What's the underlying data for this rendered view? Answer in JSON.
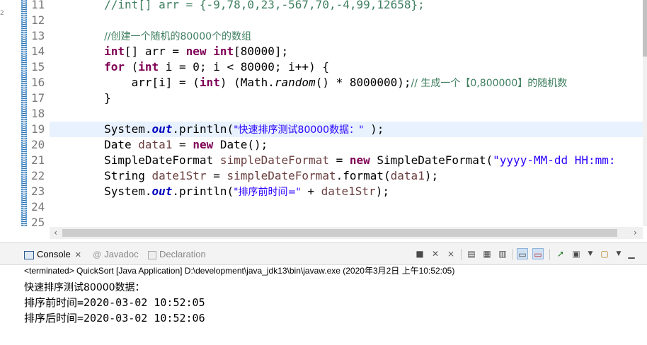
{
  "editor": {
    "gutter_mark": "2",
    "lines": [
      {
        "no": "11",
        "html_kind": "c11"
      },
      {
        "no": "12",
        "html_kind": "blank"
      },
      {
        "no": "13",
        "html_kind": "c13"
      },
      {
        "no": "14",
        "html_kind": "c14"
      },
      {
        "no": "15",
        "html_kind": "c15"
      },
      {
        "no": "16",
        "html_kind": "c16"
      },
      {
        "no": "17",
        "html_kind": "c17"
      },
      {
        "no": "18",
        "html_kind": "blank"
      },
      {
        "no": "19",
        "html_kind": "c19"
      },
      {
        "no": "20",
        "html_kind": "c20"
      },
      {
        "no": "21",
        "html_kind": "c21"
      },
      {
        "no": "22",
        "html_kind": "c22"
      },
      {
        "no": "23",
        "html_kind": "c23"
      },
      {
        "no": "24",
        "html_kind": "blank"
      },
      {
        "no": "25",
        "html_kind": "blank"
      }
    ],
    "code": {
      "l11": "        //int[] arr = {-9,78,0,23,-567,70,-4,99,12658};",
      "l13_comment": "//创建一个随机的80000个的数组",
      "l14_kw1": "int",
      "l14_a": "[] arr = ",
      "l14_kw2": "new",
      "l14_kw3": "int",
      "l14_b": "[80000];",
      "l15_kw1": "for",
      "l15_a": " (",
      "l15_kw2": "int",
      "l15_b": " i = 0; i < 80000; i++) {",
      "l16_a": "    arr[i] = (",
      "l16_kw": "int",
      "l16_b": ") (Math.",
      "l16_it": "random",
      "l16_c": "() * 8000000);",
      "l16_comment": "// 生成一个【0,800000】的随机数",
      "l17": "}",
      "l19_a": "System.",
      "l19_fld": "out",
      "l19_b": ".println(",
      "l19_str": "\"快速排序测试80000数据：\"",
      "l19_c": " );",
      "l20_a": "Date ",
      "l20_var": "data1",
      "l20_b": " = ",
      "l20_kw": "new",
      "l20_c": " Date();",
      "l21_a": "SimpleDateFormat ",
      "l21_var": "simpleDateFormat",
      "l21_b": " = ",
      "l21_kw": "new",
      "l21_c": " SimpleDateFormat(",
      "l21_str": "\"yyyy-MM-dd HH:mm:",
      "l22_a": "String ",
      "l22_var": "date1Str",
      "l22_b": " = ",
      "l22_var2": "simpleDateFormat",
      "l22_c": ".format(",
      "l22_var3": "data1",
      "l22_d": ");",
      "l23_a": "System.",
      "l23_fld": "out",
      "l23_b": ".println(",
      "l23_str": "\"排序前时间=\"",
      "l23_c": " + ",
      "l23_var": "date1Str",
      "l23_d": ");"
    },
    "hscroll": {
      "left_arrow": "‹",
      "right_arrow": "›"
    }
  },
  "console": {
    "tabs": [
      {
        "label": "Console",
        "icon": "console-icon",
        "close": "✕"
      },
      {
        "label": "Javadoc",
        "icon": "javadoc-icon"
      },
      {
        "label": "Declaration",
        "icon": "declaration-icon"
      }
    ],
    "status": "<terminated> QuickSort [Java Application] D:\\development\\java_jdk13\\bin\\javaw.exe (2020年3月2日 上午10:52:05)",
    "output": [
      "快速排序测试80000数据：",
      "排序前时间=2020-03-02 10:52:05",
      "排序后时间=2020-03-02 10:52:06"
    ]
  }
}
